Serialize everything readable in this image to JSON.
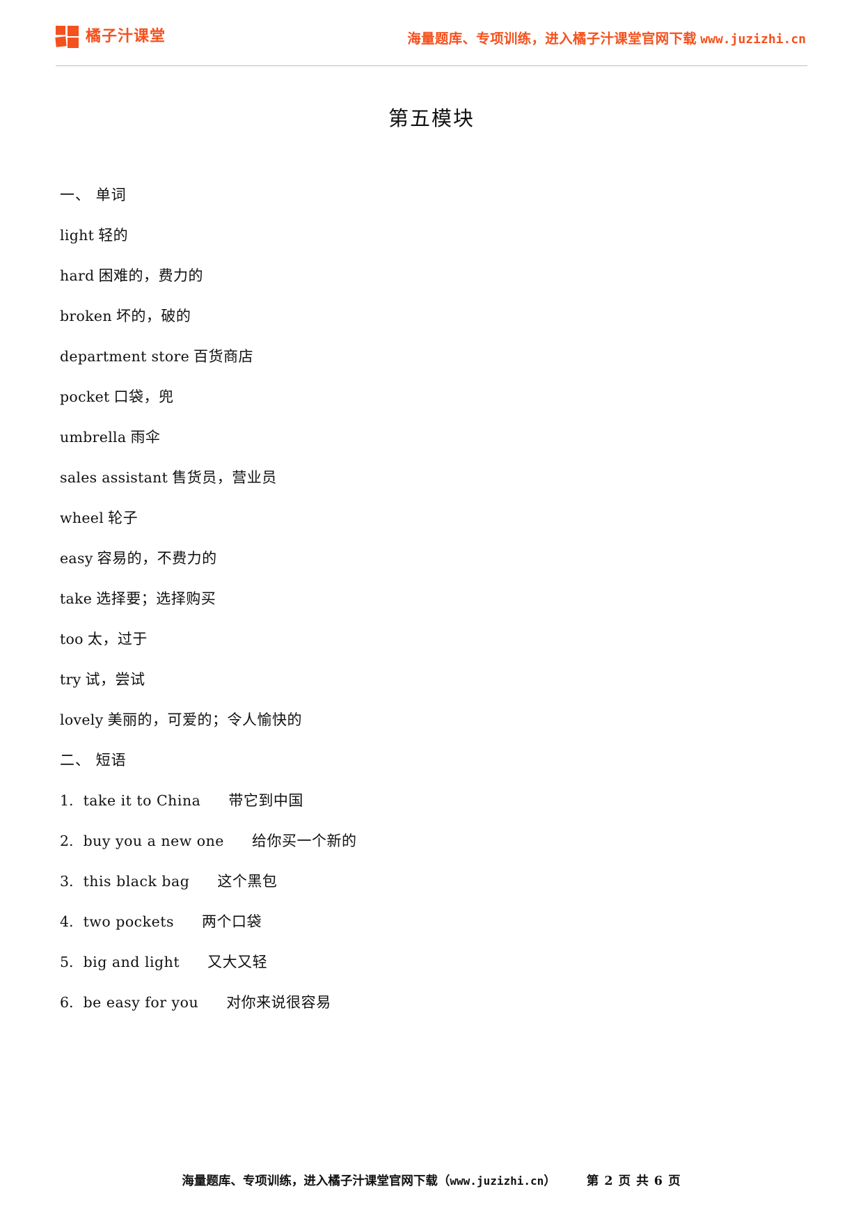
{
  "header": {
    "brand_name": "橘子汁课堂",
    "logo_icon": "four-square-grid-logo",
    "promo_text": "海量题库、专项训练，进入橘子汁课堂官网下载",
    "promo_url": "www.juzizhi.cn",
    "accent_color": "#F4511E"
  },
  "title": "第五模块",
  "sections": [
    {
      "heading": "一、 单词",
      "entries": [
        {
          "en": "light",
          "zh": "轻的"
        },
        {
          "en": "hard",
          "zh": "困难的，费力的"
        },
        {
          "en": "broken",
          "zh": "坏的，破的"
        },
        {
          "en": "department store",
          "zh": "百货商店"
        },
        {
          "en": "pocket",
          "zh": "口袋，兜"
        },
        {
          "en": "umbrella",
          "zh": "雨伞"
        },
        {
          "en": "sales assistant",
          "zh": "售货员，营业员"
        },
        {
          "en": "wheel",
          "zh": "轮子"
        },
        {
          "en": "easy",
          "zh": "容易的，不费力的"
        },
        {
          "en": "take",
          "zh": "选择要；选择购买"
        },
        {
          "en": "too",
          "zh": "太，过于"
        },
        {
          "en": "try",
          "zh": "试，尝试"
        },
        {
          "en": "lovely",
          "zh": "美丽的，可爱的；令人愉快的"
        }
      ]
    },
    {
      "heading": "二、 短语",
      "phrases": [
        {
          "num": "1.",
          "en": "take  it  to  China",
          "zh": "带它到中国"
        },
        {
          "num": "2.",
          "en": "buy  you  a  new  one",
          "zh": "给你买一个新的"
        },
        {
          "num": "3.",
          "en": "this  black  bag",
          "zh": "这个黑包"
        },
        {
          "num": "4.",
          "en": "two  pockets",
          "zh": "两个口袋"
        },
        {
          "num": "5.",
          "en": "big  and  light",
          "zh": "又大又轻"
        },
        {
          "num": "6.",
          "en": "be  easy  for  you",
          "zh": "对你来说很容易"
        }
      ]
    }
  ],
  "footer": {
    "promo_text": "海量题库、专项训练，进入橘子汁课堂官网下载（",
    "promo_url": "www.juzizhi.cn",
    "promo_text_end": "）",
    "page_label": "第 2 页 共 6 页"
  }
}
